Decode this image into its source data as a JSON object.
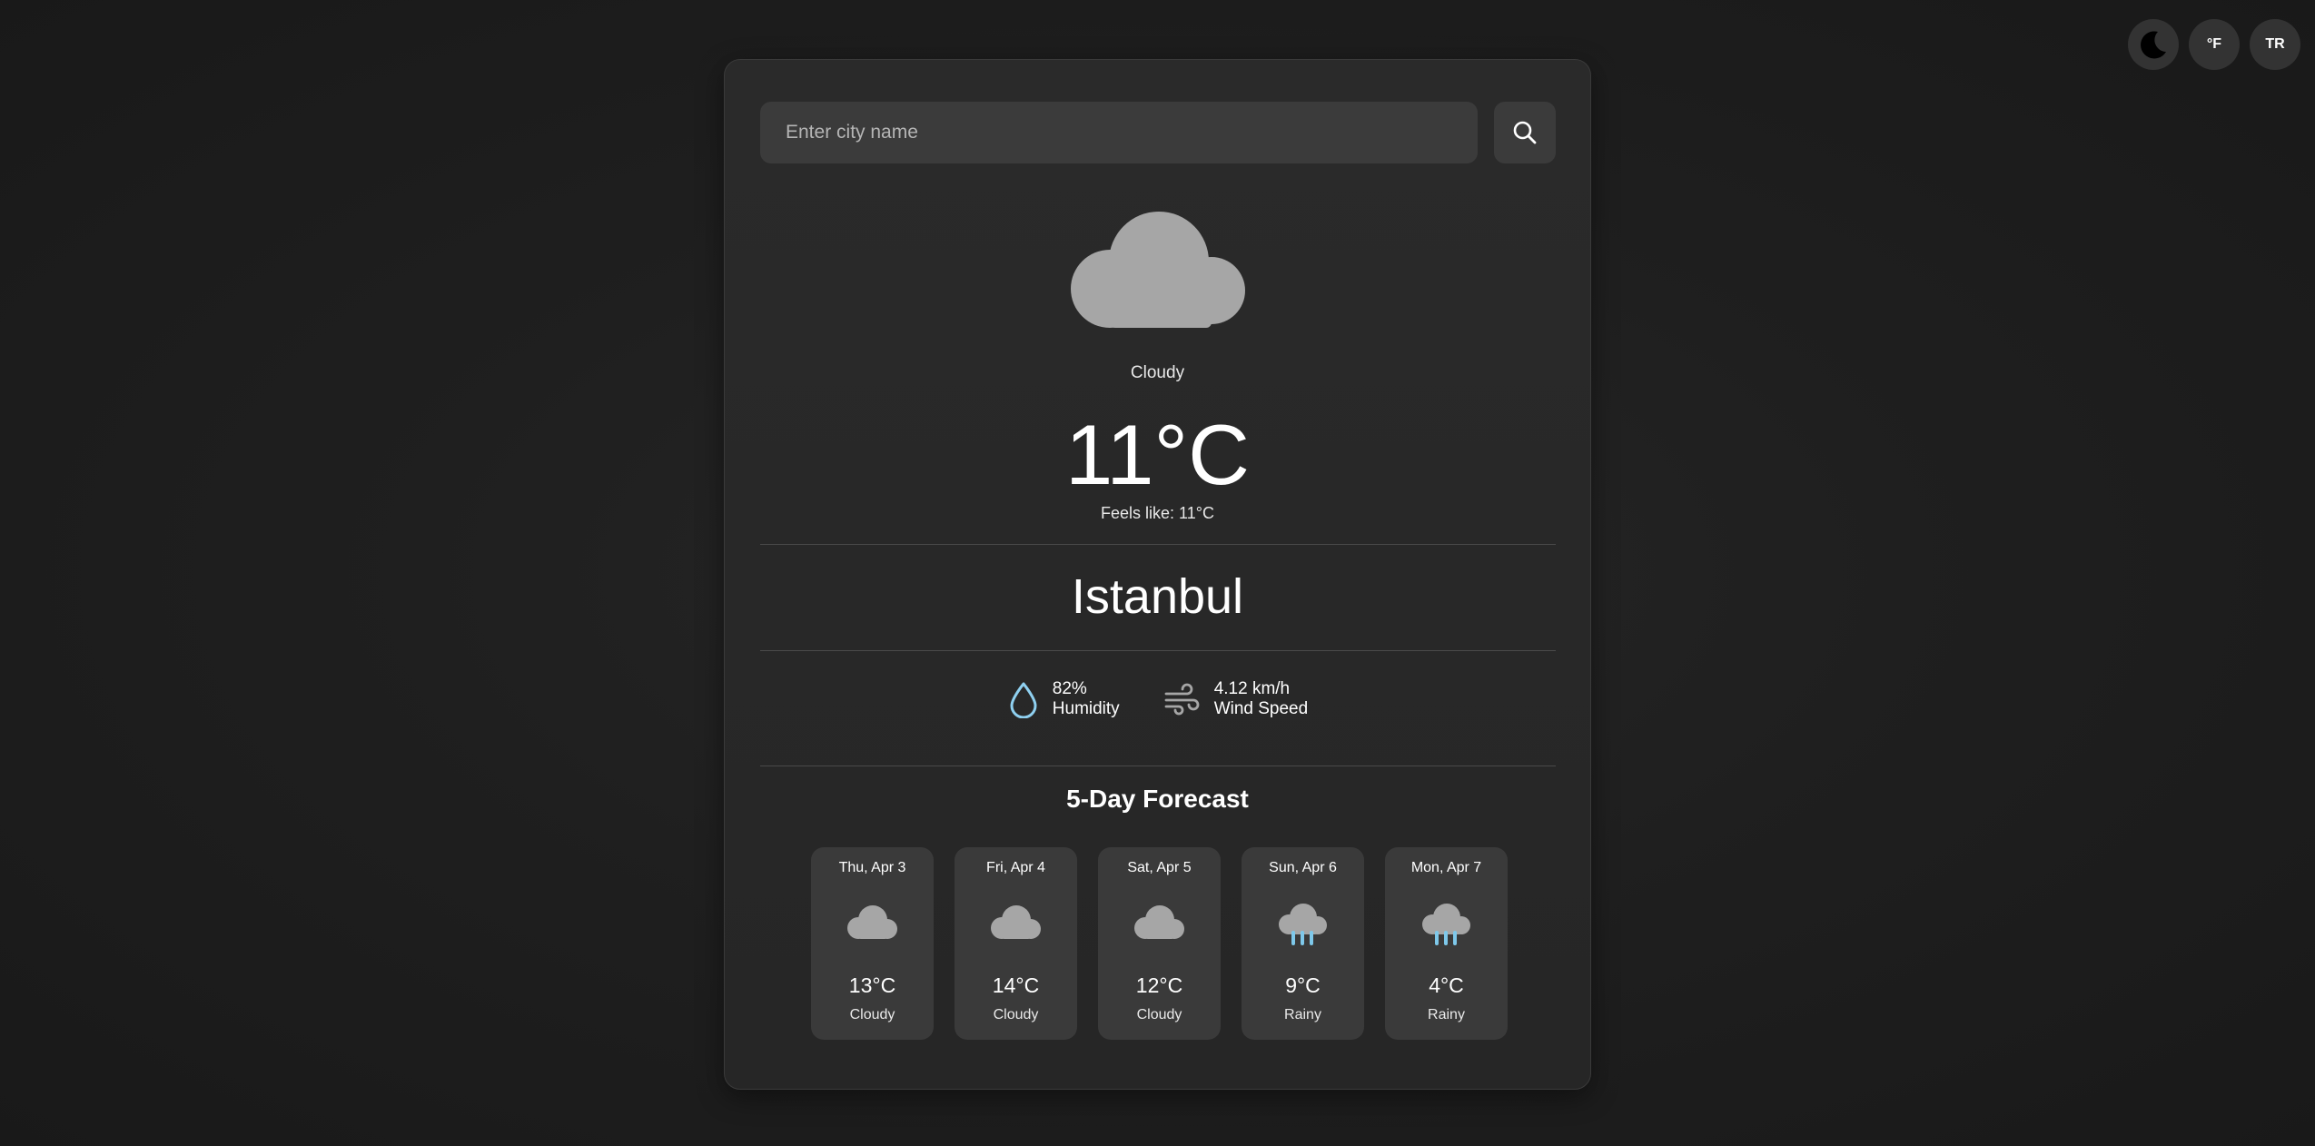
{
  "top_controls": {
    "theme_icon": "moon-icon",
    "unit_label": "°F",
    "lang_label": "TR"
  },
  "search": {
    "placeholder": "Enter city name",
    "value": "",
    "button_icon": "search-icon"
  },
  "current": {
    "icon": "cloud-icon",
    "condition": "Cloudy",
    "temperature": "11°C",
    "feels_like": "Feels like: 11°C",
    "city": "Istanbul",
    "humidity_value": "82%",
    "humidity_label": "Humidity",
    "wind_value": "4.12 km/h",
    "wind_label": "Wind Speed"
  },
  "forecast": {
    "title": "5-Day Forecast",
    "days": [
      {
        "date": "Thu, Apr 3",
        "temp": "13°C",
        "condition": "Cloudy",
        "icon": "cloud-icon"
      },
      {
        "date": "Fri, Apr 4",
        "temp": "14°C",
        "condition": "Cloudy",
        "icon": "cloud-icon"
      },
      {
        "date": "Sat, Apr 5",
        "temp": "12°C",
        "condition": "Cloudy",
        "icon": "cloud-icon"
      },
      {
        "date": "Sun, Apr 6",
        "temp": "9°C",
        "condition": "Rainy",
        "icon": "rain-cloud-icon"
      },
      {
        "date": "Mon, Apr 7",
        "temp": "4°C",
        "condition": "Rainy",
        "icon": "rain-cloud-icon"
      }
    ]
  },
  "colors": {
    "background": "#1f1f1f",
    "card": "#2a2a2a",
    "cloud": "#a6a6a6",
    "rain": "#7ec8ea",
    "humidity_icon": "#8fd0f0"
  }
}
